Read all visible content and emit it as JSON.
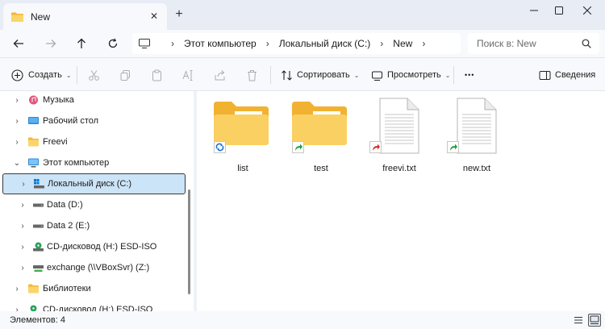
{
  "window": {
    "tab_title": "New",
    "tab_close_glyph": "✕",
    "new_tab_glyph": "+",
    "controls": [
      "minimize-icon",
      "maximize-icon",
      "close-icon"
    ]
  },
  "address": {
    "crumbs": [
      "Этот компьютер",
      "Локальный диск (C:)",
      "New"
    ],
    "separator": "›",
    "search_placeholder": "Поиск в: New"
  },
  "toolbar": {
    "create_label": "Создать",
    "sort_label": "Сортировать",
    "view_label": "Просмотреть",
    "more_label": "•••",
    "details_label": "Сведения",
    "chevron": "⌄"
  },
  "nav": {
    "items": [
      {
        "label": "Музыка",
        "icon": "music-icon"
      },
      {
        "label": "Рабочий стол",
        "icon": "desktop-icon"
      },
      {
        "label": "Freevi",
        "icon": "folder-icon"
      },
      {
        "label": "Этот компьютер",
        "icon": "computer-icon"
      },
      {
        "label": "Локальный диск (C:)",
        "icon": "windows-drive-icon"
      },
      {
        "label": "Data (D:)",
        "icon": "drive-icon"
      },
      {
        "label": "Data 2 (E:)",
        "icon": "drive-icon"
      },
      {
        "label": "CD-дисковод (H:) ESD-ISO",
        "icon": "cd-drive-icon"
      },
      {
        "label": "exchange (\\\\VBoxSvr) (Z:)",
        "icon": "network-drive-icon"
      },
      {
        "label": "Библиотеки",
        "icon": "libraries-icon"
      },
      {
        "label": "CD-дисковод (H:) ESD-ISO",
        "icon": "cd-drive-icon"
      }
    ],
    "expand_glyph": "›",
    "collapse_glyph": "⌄"
  },
  "files": [
    {
      "name": "list",
      "type": "folder",
      "badge": "symlink-badge-icon"
    },
    {
      "name": "test",
      "type": "folder",
      "badge": "shortcut-arrow-icon"
    },
    {
      "name": "freevi.txt",
      "type": "file",
      "badge": "hardlink-badge-icon"
    },
    {
      "name": "new.txt",
      "type": "file",
      "badge": "shortcut-arrow-icon"
    }
  ],
  "status": {
    "items_count": "Элементов: 4"
  },
  "colors": {
    "accent": "#0067c0",
    "folder": "#f8c848",
    "selection": "#cce4f7"
  }
}
